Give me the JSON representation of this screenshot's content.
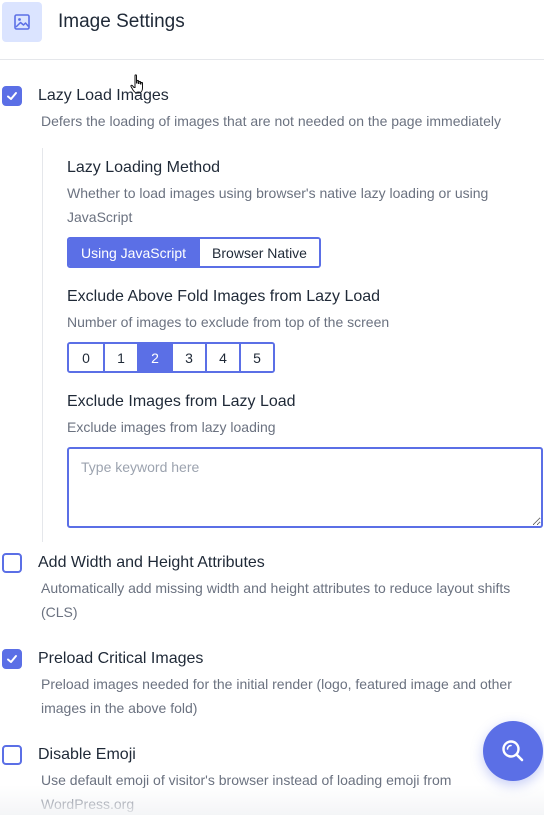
{
  "header": {
    "title": "Image Settings",
    "icon": "image-icon"
  },
  "colors": {
    "accent": "#5b6fe6",
    "header_icon_bg": "#dbe4ff",
    "text": "#1f2937",
    "muted": "#6b7280"
  },
  "options": {
    "lazy_load": {
      "label": "Lazy Load Images",
      "description": "Defers the loading of images that are not needed on the page immediately",
      "checked": true
    },
    "lazy_method": {
      "label": "Lazy Loading Method",
      "description": "Whether to load images using browser's native lazy loading or using JavaScript",
      "choices": [
        "Using JavaScript",
        "Browser Native"
      ],
      "selected": "Using JavaScript"
    },
    "exclude_fold": {
      "label": "Exclude Above Fold Images from Lazy Load",
      "description": "Number of images to exclude from top of the screen",
      "choices": [
        "0",
        "1",
        "2",
        "3",
        "4",
        "5"
      ],
      "selected": "2"
    },
    "exclude_images": {
      "label": "Exclude Images from Lazy Load",
      "description": "Exclude images from lazy loading",
      "placeholder": "Type keyword here",
      "value": ""
    },
    "width_height": {
      "label": "Add Width and Height Attributes",
      "description": "Automatically add missing width and height attributes to reduce layout shifts (CLS)",
      "checked": false
    },
    "preload_critical": {
      "label": "Preload Critical Images",
      "description": "Preload images needed for the initial render (logo, featured image and other images in the above fold)",
      "checked": true
    },
    "disable_emoji": {
      "label": "Disable Emoji",
      "description": "Use default emoji of visitor's browser instead of loading emoji from WordPress.org",
      "checked": false
    }
  },
  "fab": {
    "icon": "search-icon"
  }
}
